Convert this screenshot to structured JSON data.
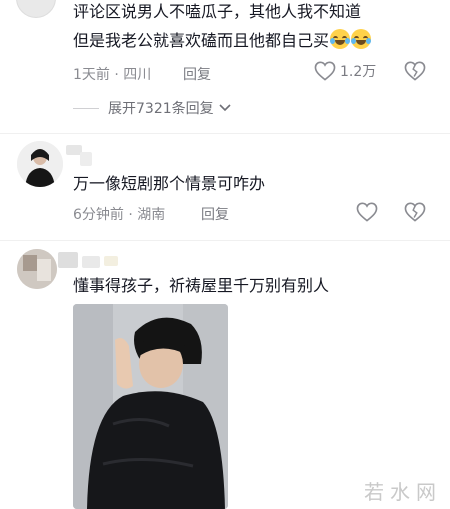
{
  "comments": [
    {
      "text_line1": "评论区说男人不嗑瓜子，其他人我不知道",
      "text_line2": "但是我老公就喜欢磕而且他都自己买",
      "time": "1天前",
      "location": "四川",
      "reply_label": "回复",
      "likes": "1.2万",
      "expand_label": "展开7321条回复"
    },
    {
      "text": "万一像短剧那个情景可咋办",
      "time": "6分钟前",
      "location": "湖南",
      "reply_label": "回复"
    },
    {
      "text": "懂事得孩子，祈祷屋里千万别有别人"
    }
  ],
  "watermark": "若水网",
  "icons": [
    "heart-icon",
    "dislike-heart-icon",
    "chevron-down-icon",
    "tears-of-joy-emoji"
  ]
}
